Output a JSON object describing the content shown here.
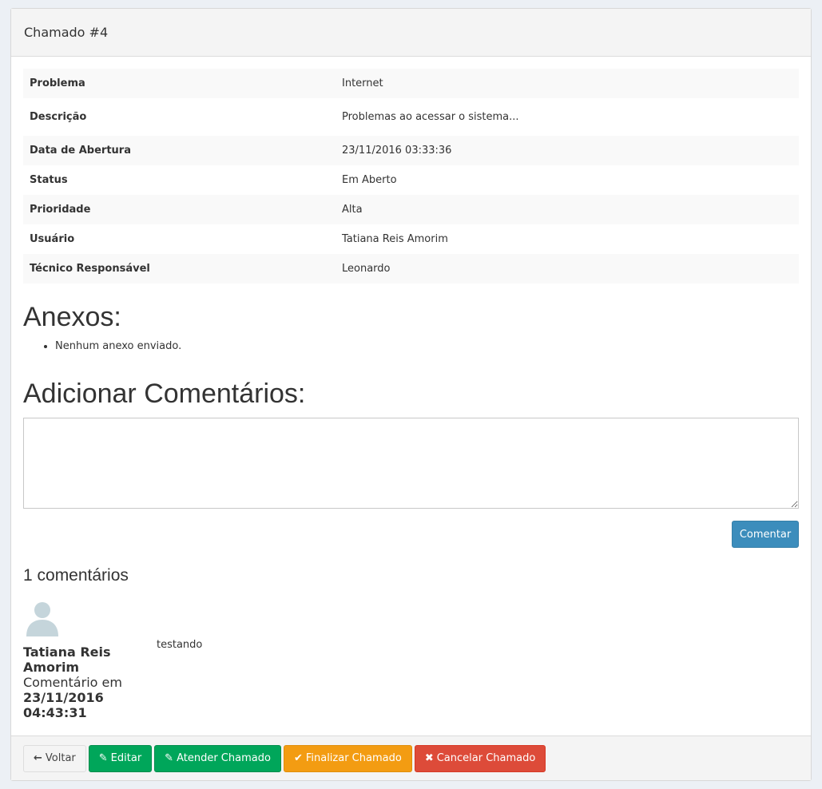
{
  "panel": {
    "title": "Chamado #4"
  },
  "details": [
    {
      "key": "Problema",
      "value": "Internet"
    },
    {
      "key": "Descrição",
      "value": "Problemas ao acessar o sistema..."
    },
    {
      "key": "Data de Abertura",
      "value": "23/11/2016 03:33:36"
    },
    {
      "key": "Status",
      "value": "Em Aberto"
    },
    {
      "key": "Prioridade",
      "value": "Alta"
    },
    {
      "key": "Usuário",
      "value": "Tatiana Reis Amorim"
    },
    {
      "key": "Técnico Responsável",
      "value": "Leonardo"
    }
  ],
  "attachments": {
    "title": "Anexos:",
    "items": [
      "Nenhum anexo enviado."
    ]
  },
  "add_comment": {
    "title": "Adicionar Comentários:",
    "textarea_value": "",
    "submit_label": "Comentar"
  },
  "comments": {
    "count_label": "1 comentários",
    "items": [
      {
        "author": "Tatiana Reis Amorim",
        "label": "Comentário em",
        "date": "23/11/2016 04:43:31",
        "text": "testando",
        "avatar_icon": "user-avatar-icon"
      }
    ]
  },
  "footer": {
    "back_label": "Voltar",
    "edit_label": "Editar",
    "attend_label": "Atender Chamado",
    "finish_label": "Finalizar Chamado",
    "cancel_label": "Cancelar Chamado"
  },
  "colors": {
    "primary": "#3c8dbc",
    "success": "#00a65a",
    "warning": "#f39c12",
    "danger": "#dd4b39"
  }
}
